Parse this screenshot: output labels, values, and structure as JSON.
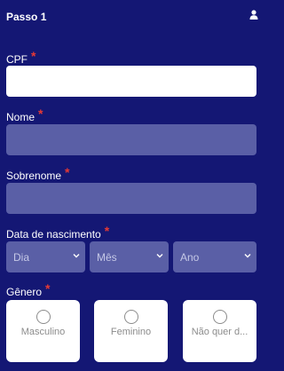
{
  "header": {
    "title": "Passo 1",
    "icon": "user-icon"
  },
  "form": {
    "required_marker": "*",
    "cpf": {
      "label": "CPF",
      "value": ""
    },
    "nome": {
      "label": "Nome",
      "value": ""
    },
    "sobrenome": {
      "label": "Sobrenome",
      "value": ""
    },
    "nascimento": {
      "label": "Data de nascimento",
      "dia": "Dia",
      "mes": "Mês",
      "ano": "Ano"
    },
    "genero": {
      "label": "Gênero",
      "options": [
        "Masculino",
        "Feminino",
        "Não quer d..."
      ]
    }
  },
  "colors": {
    "background": "#141774",
    "required": "#e53935",
    "muted_field": "#5a5fa6"
  }
}
